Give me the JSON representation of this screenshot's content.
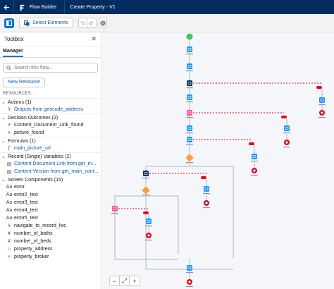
{
  "header": {
    "app_name": "Flow Builder",
    "flow_title": "Create Property - V1"
  },
  "toolbar": {
    "select_elements_label": "Select Elements"
  },
  "toolbox": {
    "title": "Toolbox",
    "tab_label": "Manager",
    "search_placeholder": "Search this flow...",
    "new_resource_label": "New Resource",
    "resources_label": "RESOURCES",
    "sections": [
      {
        "label": "Actions (1)",
        "items": [
          {
            "label": "Outputs from geocode_address",
            "link": true,
            "icon": "bolt-icon"
          }
        ]
      },
      {
        "label": "Decision Outcomes (2)",
        "items": [
          {
            "label": "Content_Document_Link_found",
            "link": false,
            "icon": "decision-icon"
          },
          {
            "label": "picture_found",
            "link": false,
            "icon": "decision-icon"
          }
        ]
      },
      {
        "label": "Formulas (1)",
        "items": [
          {
            "label": "main_picture_url",
            "link": true,
            "icon": "formula-icon"
          }
        ]
      },
      {
        "label": "Record (Single) Variables (2)",
        "items": [
          {
            "label": "Content Document Link from get_m...",
            "link": true,
            "icon": "record-icon"
          },
          {
            "label": "Content Version from get_main_cont...",
            "link": true,
            "icon": "record-icon"
          }
        ]
      },
      {
        "label": "Screen Components (15)",
        "items": [
          {
            "label": "error",
            "link": false,
            "icon": "text-icon"
          },
          {
            "label": "error2_text",
            "link": false,
            "icon": "text-icon"
          },
          {
            "label": "error3_text",
            "link": false,
            "icon": "text-icon"
          },
          {
            "label": "error4_text",
            "link": false,
            "icon": "text-icon"
          },
          {
            "label": "error5_text",
            "link": false,
            "icon": "text-icon"
          },
          {
            "label": "navigate_to_record_lwc",
            "link": false,
            "icon": "lightning-component-icon"
          },
          {
            "label": "number_of_baths",
            "link": false,
            "icon": "number-icon"
          },
          {
            "label": "number_of_beds",
            "link": false,
            "icon": "number-icon"
          },
          {
            "label": "property_address",
            "link": false,
            "icon": "address-icon"
          },
          {
            "label": "property_broker",
            "link": false,
            "icon": "lookup-icon"
          }
        ]
      }
    ]
  },
  "colors": {
    "header_bg": "#032d60",
    "accent": "#0176d3",
    "screen_node": "#1b96ff",
    "action_node": "#032d60",
    "decision_node": "#ff9a3c",
    "assignment_node": "#ff538a",
    "fault_node": "#ea001e"
  }
}
